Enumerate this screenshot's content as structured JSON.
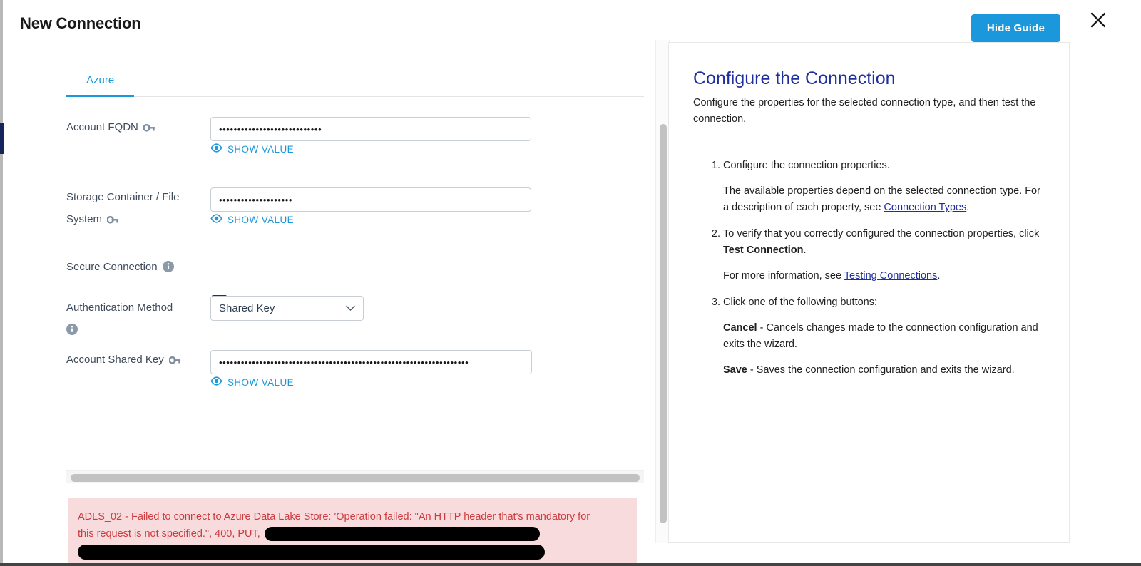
{
  "dialog": {
    "title": "New Connection",
    "hide_guide_label": "Hide Guide",
    "close_icon": "close-icon"
  },
  "form": {
    "tabs": [
      {
        "label": "Azure",
        "active": true
      }
    ],
    "fields": [
      {
        "label": "Account FQDN",
        "icon": "key-icon",
        "type": "password",
        "value": "••••••••••••••••••••••••••••",
        "show_value_label": "SHOW VALUE",
        "show_value_icon": "eye-icon"
      },
      {
        "label": "Storage Container / File System",
        "icon": "key-icon",
        "type": "password",
        "value": "••••••••••••••••••••",
        "show_value_label": "SHOW VALUE",
        "show_value_icon": "eye-icon"
      },
      {
        "label": "Secure Connection",
        "icon": "info-icon",
        "type": "checkbox",
        "checked": true
      },
      {
        "label": "Authentication Method",
        "icon": "info-icon",
        "type": "select",
        "value": "Shared Key",
        "options": [
          "Shared Key"
        ],
        "chevron_icon": "chevron-down-icon"
      },
      {
        "label": "Account Shared Key",
        "icon": "key-icon",
        "type": "password",
        "value": "••••••••••••••••••••••••••••••••••••••••••••••••••••••••••••••••••••",
        "show_value_label": "SHOW VALUE",
        "show_value_icon": "eye-icon"
      }
    ],
    "error": {
      "line1": "ADLS_02 - Failed to connect to Azure Data Lake Store: 'Operation failed: \"An HTTP header that's mandatory for",
      "line2": "this request is not specified.\", 400, PUT, ",
      "redacted_1": "[redacted]",
      "redacted_2": "[redacted]",
      "color": "#cc3b3f",
      "background": "#f8dcdd"
    }
  },
  "guide": {
    "title": "Configure the Connection",
    "intro": "Configure the properties for the selected connection type, and then test the connection.",
    "steps": [
      {
        "text": "Configure the connection properties.",
        "detail_pre": "The available properties depend on the selected connection type. For a description of each property, see ",
        "detail_link": "Connection Types",
        "detail_post": "."
      },
      {
        "text_pre": "To verify that you correctly configured the connection properties, click ",
        "text_bold": "Test Connection",
        "text_post": ".",
        "detail_pre": "For more information, see ",
        "detail_link": "Testing Connections",
        "detail_post": "."
      },
      {
        "text": "Click one of the following buttons:",
        "bullets": [
          {
            "bold": "Cancel",
            "rest": " - Cancels changes made to the connection configuration and exits the wizard."
          },
          {
            "bold": "Save",
            "rest": " - Saves the connection configuration and exits the wizard."
          }
        ]
      }
    ]
  },
  "colors": {
    "accent_blue": "#1b98db",
    "link_blue": "#1f2fa0",
    "checkbox_navy": "#1f3068",
    "error_red": "#cc3b3f",
    "rail_navy": "#16235c"
  }
}
